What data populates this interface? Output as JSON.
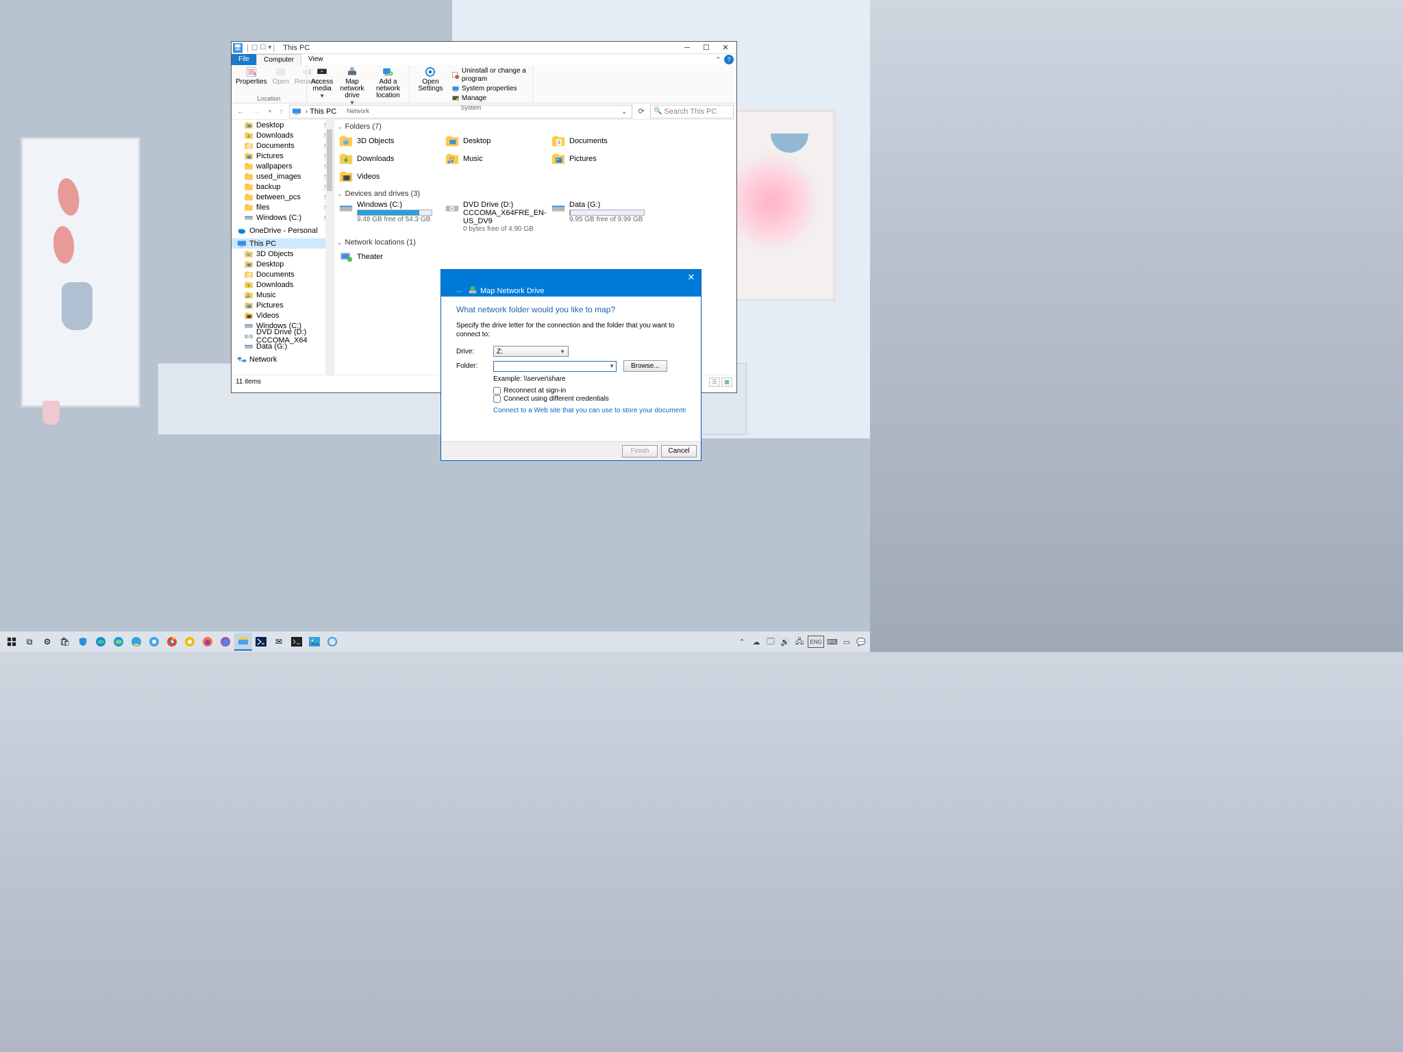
{
  "window": {
    "title": "This PC",
    "tabs": {
      "file": "File",
      "computer": "Computer",
      "view": "View"
    },
    "ribbon": {
      "location": {
        "label": "Location",
        "properties": "Properties",
        "open": "Open",
        "rename": "Rename"
      },
      "network": {
        "label": "Network",
        "access_media": "Access media",
        "map_drive": "Map network drive",
        "add_loc": "Add a network location"
      },
      "system": {
        "label": "System",
        "open_settings": "Open Settings",
        "uninstall": "Uninstall or change a program",
        "sys_props": "System properties",
        "manage": "Manage"
      }
    },
    "addr": {
      "path": "This PC",
      "search_ph": "Search This PC"
    },
    "tree": {
      "quick": [
        {
          "label": "Desktop",
          "icon": "desktop"
        },
        {
          "label": "Downloads",
          "icon": "download"
        },
        {
          "label": "Documents",
          "icon": "document"
        },
        {
          "label": "Pictures",
          "icon": "pictures"
        },
        {
          "label": "wallpapers",
          "icon": "folder"
        },
        {
          "label": "used_images",
          "icon": "folder"
        },
        {
          "label": "backup",
          "icon": "folder"
        },
        {
          "label": "between_pcs",
          "icon": "folder"
        },
        {
          "label": "files",
          "icon": "folder"
        },
        {
          "label": "Windows (C:)",
          "icon": "drive"
        }
      ],
      "onedrive": "OneDrive - Personal",
      "thispc": "This PC",
      "thispc_items": [
        {
          "label": "3D Objects",
          "icon": "3d"
        },
        {
          "label": "Desktop",
          "icon": "desktop"
        },
        {
          "label": "Documents",
          "icon": "document"
        },
        {
          "label": "Downloads",
          "icon": "download"
        },
        {
          "label": "Music",
          "icon": "music"
        },
        {
          "label": "Pictures",
          "icon": "pictures"
        },
        {
          "label": "Videos",
          "icon": "videos"
        },
        {
          "label": "Windows (C:)",
          "icon": "drive"
        },
        {
          "label": "DVD Drive (D:) CCCOMA_X64",
          "icon": "dvd"
        },
        {
          "label": "Data (G:)",
          "icon": "drive"
        }
      ],
      "network": "Network"
    },
    "content": {
      "folders_hdr": "Folders (7)",
      "folders": [
        {
          "label": "3D Objects",
          "icon": "3d"
        },
        {
          "label": "Desktop",
          "icon": "desktop"
        },
        {
          "label": "Documents",
          "icon": "document"
        },
        {
          "label": "Downloads",
          "icon": "download"
        },
        {
          "label": "Music",
          "icon": "music"
        },
        {
          "label": "Pictures",
          "icon": "pictures"
        },
        {
          "label": "Videos",
          "icon": "videos"
        }
      ],
      "drives_hdr": "Devices and drives (3)",
      "drives": [
        {
          "label": "Windows (C:)",
          "sub": "9.48 GB free of 54.3 GB",
          "fill": 83,
          "color": "#26a0da"
        },
        {
          "label": "DVD Drive (D:)",
          "label2": "CCCOMA_X64FRE_EN-US_DV9",
          "sub": "0 bytes free of 4.90 GB",
          "fill": 0,
          "nobar": true
        },
        {
          "label": "Data (G:)",
          "sub": "9.95 GB free of 9.99 GB",
          "fill": 1,
          "color": "#26a0da"
        }
      ],
      "netloc_hdr": "Network locations (1)",
      "netloc": [
        {
          "label": "Theater"
        }
      ]
    },
    "status": "11 items"
  },
  "dialog": {
    "title": "Map Network Drive",
    "question": "What network folder would you like to map?",
    "instr": "Specify the drive letter for the connection and the folder that you want to connect to:",
    "drive_lbl": "Drive:",
    "drive_val": "Z:",
    "folder_lbl": "Folder:",
    "browse": "Browse...",
    "example": "Example: \\\\server\\share",
    "reconnect": "Reconnect at sign-in",
    "diff_creds": "Connect using different credentials",
    "link": "Connect to a Web site that you can use to store your documents and pi",
    "finish": "Finish",
    "cancel": "Cancel"
  }
}
